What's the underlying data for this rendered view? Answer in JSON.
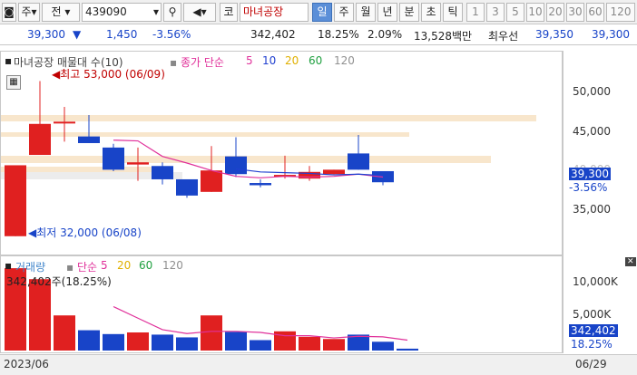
{
  "toolbar": {
    "market": "주",
    "kind": "전",
    "code": "439090",
    "mode": "코",
    "name": "마녀공장",
    "periods": [
      "일",
      "주",
      "월",
      "년",
      "분",
      "초",
      "틱"
    ],
    "numbers": [
      "1",
      "3",
      "5",
      "10",
      "20",
      "30",
      "60",
      "120"
    ]
  },
  "info": {
    "price": "39,300",
    "change": "1,450",
    "change_pct": "-3.56%",
    "volume": "342,402",
    "turnover": "18.25%",
    "ratio": "2.09%",
    "amount": "13,528백만",
    "bid_label": "최우선",
    "bid": "39,350",
    "ask": "39,300"
  },
  "main": {
    "title": "마녀공장 매물대 수(10)",
    "ma_label": "종가 단순",
    "ma_values": [
      "5",
      "10",
      "20",
      "60",
      "120"
    ],
    "ma_colors": [
      "#e0309a",
      "#2040d0",
      "#e0b000",
      "#20a040",
      "#909090"
    ],
    "high_label": "최고 53,000 (06/09)",
    "low_label": "최저 32,000 (06/08)",
    "price_badge": "39,300",
    "price_badge_pct": "-3.56%"
  },
  "volume": {
    "title": "거래량",
    "ma_label": "단순",
    "ma_values": [
      "5",
      "20",
      "60",
      "120"
    ],
    "ma_colors": [
      "#e0309a",
      "#e0b000",
      "#20a040",
      "#909090"
    ],
    "current": "342,402주(18.25%)",
    "badge": "342,402",
    "badge_pct": "18.25%"
  },
  "axis": {
    "price_ticks": [
      "50,000",
      "45,000",
      "40,000",
      "35,000"
    ],
    "volume_ticks": [
      "10,000K",
      "5,000K"
    ]
  },
  "dates": {
    "start": "2023/06",
    "end": "06/29"
  },
  "chart_data": {
    "type": "candlestick",
    "title": "마녀공장 매물대 수(10)",
    "ylim": [
      30500,
      56000
    ],
    "candles": [
      {
        "o": 41600,
        "h": 41600,
        "l": 32000,
        "c": 32000
      },
      {
        "o": 43000,
        "h": 53000,
        "l": 43000,
        "c": 47200
      },
      {
        "o": 47500,
        "h": 49500,
        "l": 44800,
        "c": 47500
      },
      {
        "o": 45500,
        "h": 48400,
        "l": 44600,
        "c": 44600
      },
      {
        "o": 44000,
        "h": 44500,
        "l": 40800,
        "c": 41000
      },
      {
        "o": 42000,
        "h": 44000,
        "l": 39500,
        "c": 41700
      },
      {
        "o": 41500,
        "h": 42000,
        "l": 39000,
        "c": 39700
      },
      {
        "o": 39700,
        "h": 39700,
        "l": 37200,
        "c": 37500
      },
      {
        "o": 38000,
        "h": 44200,
        "l": 38000,
        "c": 40900
      },
      {
        "o": 42800,
        "h": 45400,
        "l": 40000,
        "c": 40400
      },
      {
        "o": 39200,
        "h": 39700,
        "l": 38600,
        "c": 38900
      },
      {
        "o": 40300,
        "h": 42900,
        "l": 39800,
        "c": 40300
      },
      {
        "o": 39800,
        "h": 41500,
        "l": 39500,
        "c": 40700
      },
      {
        "o": 40400,
        "h": 41000,
        "l": 40400,
        "c": 41000
      },
      {
        "o": 43200,
        "h": 45700,
        "l": 41000,
        "c": 41000
      },
      {
        "o": 40800,
        "h": 40800,
        "l": 38900,
        "c": 39300
      }
    ],
    "ma5": [
      null,
      null,
      null,
      null,
      45000,
      44900,
      42800,
      41900,
      40900,
      40100,
      39900,
      40100,
      40000,
      40100,
      40400,
      40000
    ],
    "ma10": [
      null,
      null,
      null,
      null,
      null,
      null,
      null,
      null,
      null,
      41100,
      40700,
      40600,
      40500,
      40300,
      40400,
      40200
    ],
    "volume_k": [
      15000,
      13000,
      6400,
      3700,
      3000,
      3300,
      2900,
      2400,
      6400,
      3400,
      1900,
      3500,
      2500,
      2100,
      2900,
      1600,
      342
    ],
    "volume_ma5": [
      null,
      null,
      null,
      null,
      8000,
      5900,
      3800,
      3100,
      3500,
      3500,
      3300,
      2700,
      2700,
      2300,
      2600,
      2500,
      1900
    ],
    "candle_colors": [
      "#e02020",
      "#e02020",
      "#e02020",
      "#1844c8",
      "#1844c8",
      "#e02020",
      "#1844c8",
      "#1844c8",
      "#e02020",
      "#1844c8",
      "#1844c8",
      "#e02020",
      "#e02020",
      "#e02020",
      "#1844c8",
      "#1844c8"
    ]
  }
}
